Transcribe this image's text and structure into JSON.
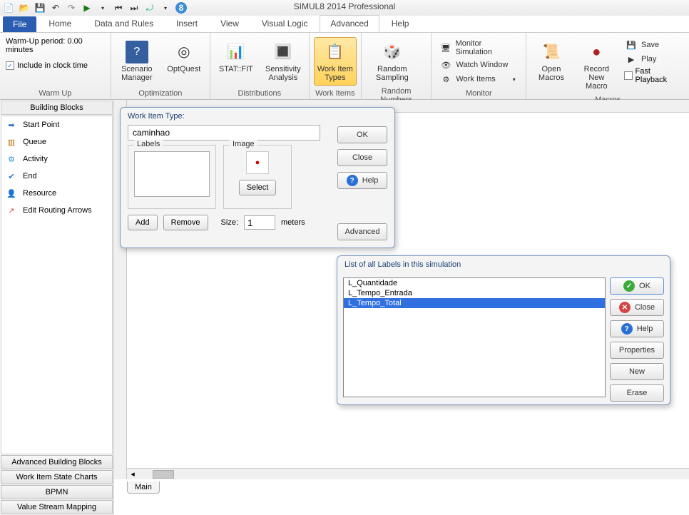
{
  "app_title": "SIMUL8 2014 Professional",
  "menu": {
    "file": "File",
    "tabs": [
      "Home",
      "Data and Rules",
      "Insert",
      "View",
      "Visual Logic",
      "Advanced",
      "Help"
    ],
    "active": "Advanced"
  },
  "ribbon": {
    "warmup": {
      "period_label": "Warm-Up period: 0.00 minutes",
      "include_clock": "Include in clock time",
      "group": "Warm Up"
    },
    "optimization": {
      "scenario": "Scenario\nManager",
      "optquest": "OptQuest",
      "group": "Optimization"
    },
    "distributions": {
      "statfit": "STAT::FIT",
      "sensitivity": "Sensitivity\nAnalysis",
      "group": "Distributions"
    },
    "workitems": {
      "types": "Work Item\nTypes",
      "group": "Work Items"
    },
    "random": {
      "sampling": "Random\nSampling",
      "group": "Random Numbers"
    },
    "monitor": {
      "monitor_sim": "Monitor Simulation",
      "watch_window": "Watch Window",
      "work_items": "Work Items",
      "group": "Monitor"
    },
    "macros": {
      "open": "Open\nMacros",
      "record": "Record\nNew Macro",
      "save": "Save",
      "play": "Play",
      "fast": "Fast Playback",
      "group": "Macros"
    }
  },
  "sidebar": {
    "header": "Building Blocks",
    "items": [
      {
        "label": "Start Point"
      },
      {
        "label": "Queue"
      },
      {
        "label": "Activity"
      },
      {
        "label": "End"
      },
      {
        "label": "Resource"
      },
      {
        "label": "Edit Routing Arrows"
      }
    ],
    "bottom": [
      "Advanced Building Blocks",
      "Work Item State Charts",
      "BPMN",
      "Value Stream Mapping"
    ]
  },
  "dialog_workitem": {
    "title": "Work Item Type:",
    "name_value": "caminhao",
    "labels_caption": "Labels",
    "image_caption": "Image",
    "add": "Add",
    "remove": "Remove",
    "select": "Select",
    "size_label": "Size:",
    "size_value": "1",
    "size_unit": "meters",
    "ok": "OK",
    "close": "Close",
    "help": "Help",
    "advanced": "Advanced"
  },
  "dialog_labels": {
    "title": "List of all Labels in this simulation",
    "items": [
      "L_Quantidade",
      "L_Tempo_Entrada",
      "L_Tempo_Total"
    ],
    "selected_index": 2,
    "ok": "OK",
    "close": "Close",
    "help": "Help",
    "properties": "Properties",
    "new": "New",
    "erase": "Erase"
  },
  "main_tab": "Main"
}
